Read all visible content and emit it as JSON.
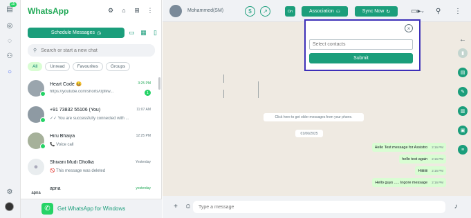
{
  "rail": {
    "badge": "15"
  },
  "sidebar": {
    "brand": "WhatsApp",
    "schedule_label": "Schedule Messages",
    "search_placeholder": "Search or start a new chat",
    "chips": [
      "All",
      "Unread",
      "Favourites",
      "Groups"
    ],
    "chats": [
      {
        "name": "Heart Code 😃",
        "preview": "https://youtube.com/shorts/0pfkw...",
        "time": "3:25 PM",
        "time_green": true,
        "unread": "1"
      },
      {
        "name": "+91 73832 55106 (You)",
        "preview": "✓✓ You are successfully connected with ...",
        "time": "11:07 AM",
        "time_green": false,
        "unread": ""
      },
      {
        "name": "Hiru Bhaiya",
        "preview": "📞 Voice call",
        "time": "12:25 PM",
        "time_green": false,
        "unread": ""
      },
      {
        "name": "Shivani Mudi Dholka",
        "preview": "🚫 This message was deleted",
        "time": "Yesterday",
        "time_green": false,
        "unread": ""
      },
      {
        "name": "apna",
        "preview": "",
        "time": "yesterday",
        "time_green": true,
        "unread": ""
      }
    ],
    "get_windows": "Get WhatsApp for Windows"
  },
  "conversation": {
    "contact_name": "Mohammed(SM)",
    "on_label": "On",
    "association_label": "Association",
    "sync_label": "Sync Now",
    "older_messages": "Click here to get older messages from your phone.",
    "date_divider": "01/06/2025",
    "messages": [
      {
        "text": "Hello Test message for Assistro",
        "time": "2:16 PM"
      },
      {
        "text": "hello test again",
        "time": "2:16 PM"
      },
      {
        "text": "Hiiiiiiii",
        "time": "2:16 PM"
      },
      {
        "text": "Hello guys ..... Ingore message",
        "time": "2:16 PM"
      }
    ],
    "composer_placeholder": "Type a message"
  },
  "popup": {
    "contacts_placeholder": "Select contacts",
    "submit_label": "Submit"
  },
  "colors": {
    "brand_green": "#1fa855",
    "teal": "#1b9e7b",
    "popup_border": "#3c2fb8"
  }
}
